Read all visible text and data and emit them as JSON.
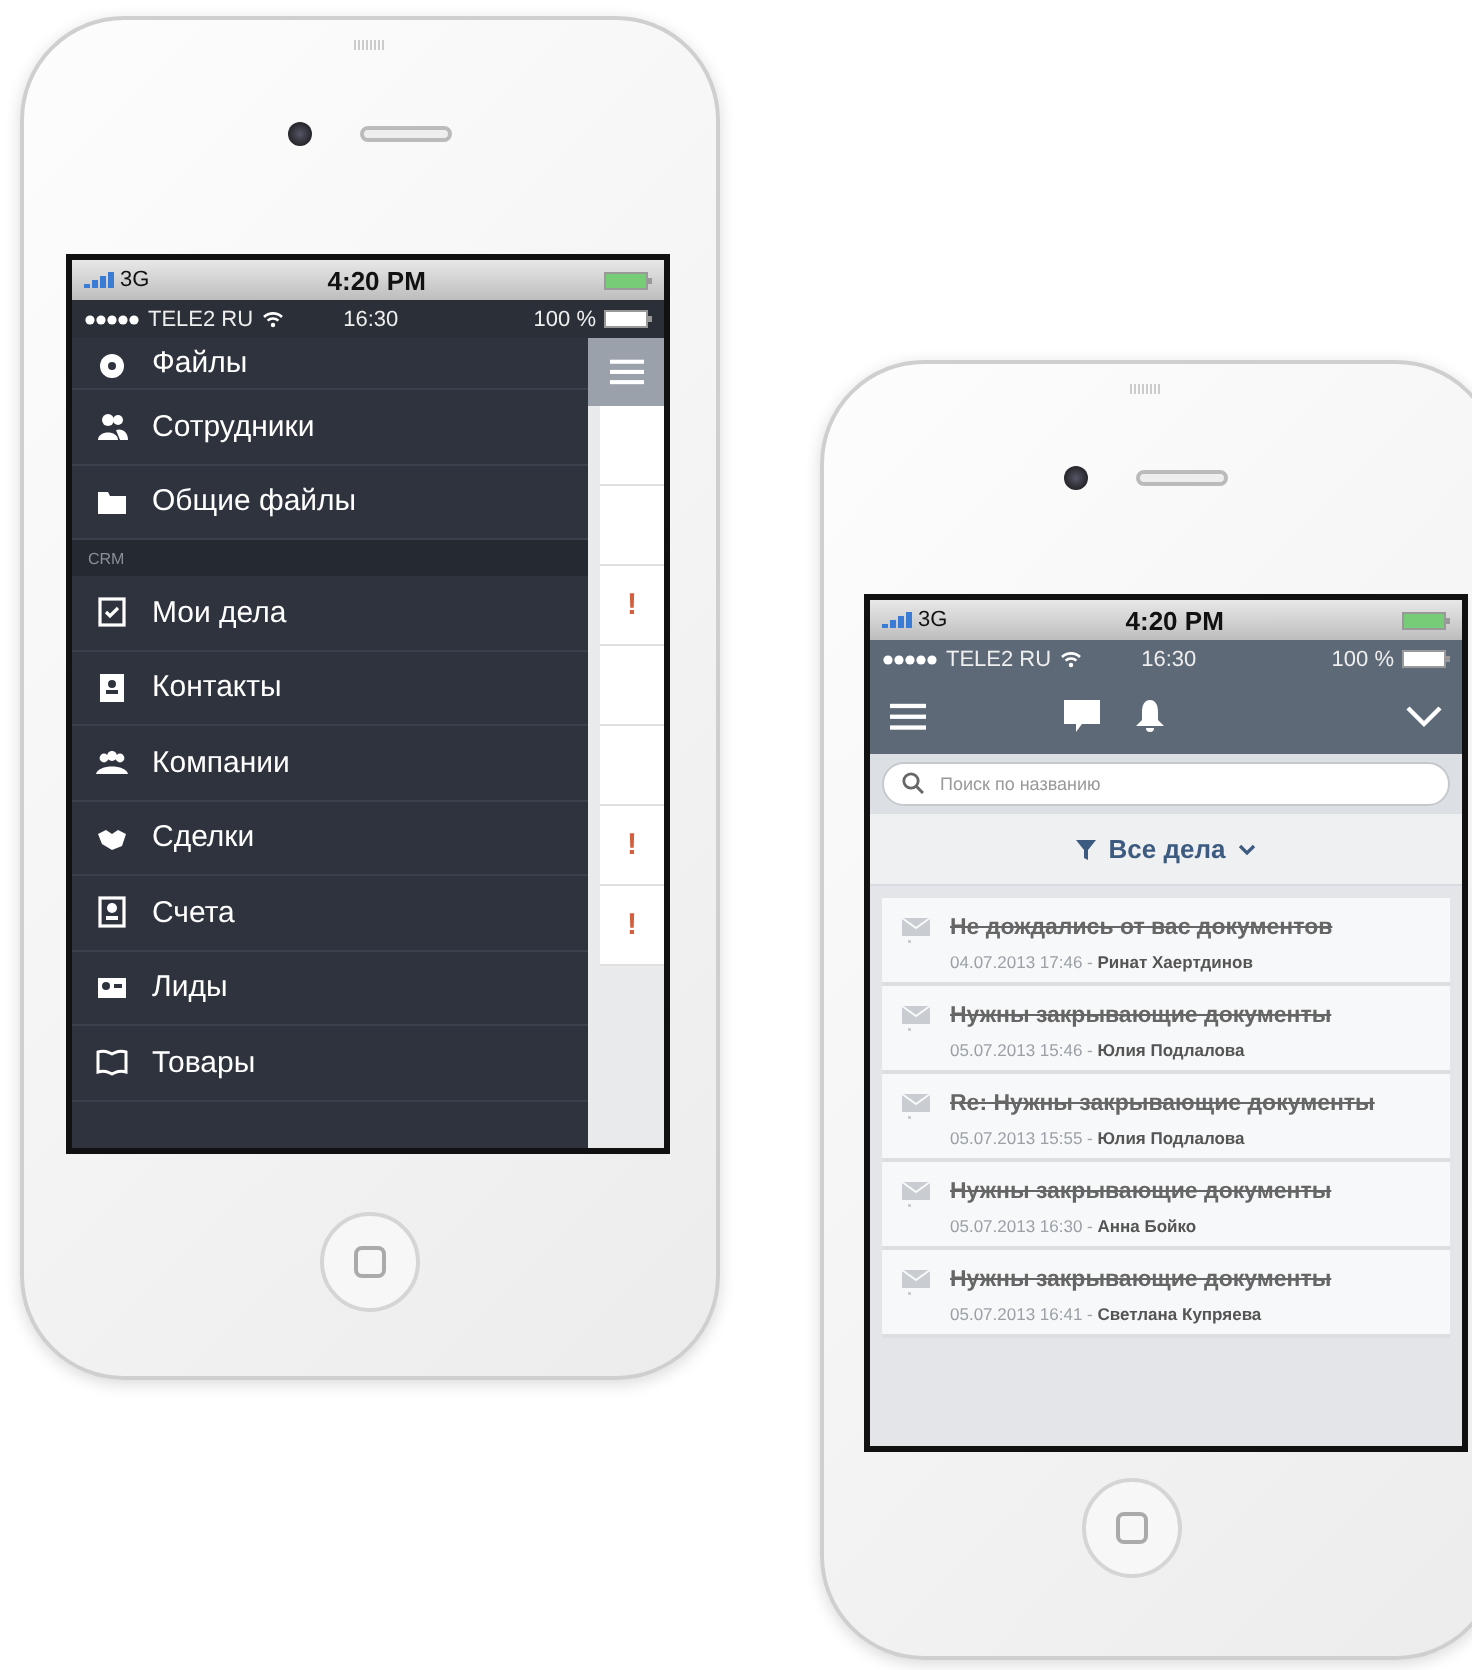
{
  "left_phone": {
    "os_status": {
      "network": "3G",
      "time": "4:20 PM"
    },
    "app_status": {
      "carrier": "TELE2 RU",
      "time": "16:30",
      "battery": "100 %"
    },
    "menu": [
      {
        "kind": "item",
        "label": "Файлы"
      },
      {
        "kind": "item",
        "label": "Сотрудники"
      },
      {
        "kind": "item",
        "label": "Общие файлы"
      },
      {
        "kind": "section",
        "label": "CRM"
      },
      {
        "kind": "item",
        "label": "Мои дела"
      },
      {
        "kind": "item",
        "label": "Контакты"
      },
      {
        "kind": "item",
        "label": "Компании"
      },
      {
        "kind": "item",
        "label": "Сделки"
      },
      {
        "kind": "item",
        "label": "Счета"
      },
      {
        "kind": "item",
        "label": "Лиды"
      },
      {
        "kind": "item",
        "label": "Товары"
      }
    ],
    "peek_rows": [
      {
        "kind": "plain"
      },
      {
        "kind": "plain"
      },
      {
        "kind": "alert",
        "mark": "!"
      },
      {
        "kind": "plain"
      },
      {
        "kind": "plain"
      },
      {
        "kind": "alert",
        "mark": "!"
      },
      {
        "kind": "alert",
        "mark": "!"
      }
    ]
  },
  "right_phone": {
    "os_status": {
      "network": "3G",
      "time": "4:20 PM"
    },
    "app_status": {
      "carrier": "TELE2 RU",
      "time": "16:30",
      "battery": "100 %"
    },
    "search": {
      "placeholder": "Поиск по названию"
    },
    "filter": {
      "label": "Все дела"
    },
    "tasks": [
      {
        "title": "Не дождались от вас документов",
        "meta": "04.07.2013 17:46  - **Ринат Хаертдинов**",
        "done": true
      },
      {
        "title": "Нужны закрывающие документы",
        "meta": "05.07.2013 15:46  - **Юлия Подлалова**",
        "done": true
      },
      {
        "title": "Re: Нужны закрывающие документы",
        "meta": "05.07.2013 15:55  - **Юлия Подлалова**",
        "done": true
      },
      {
        "title": "Нужны закрывающие документы",
        "meta": "05.07.2013 16:30  - **Анна Бойко**",
        "done": true
      },
      {
        "title": "Нужны закрывающие документы",
        "meta": "05.07.2013 16:41  - **Светлана Купряева**",
        "done": true
      }
    ]
  }
}
